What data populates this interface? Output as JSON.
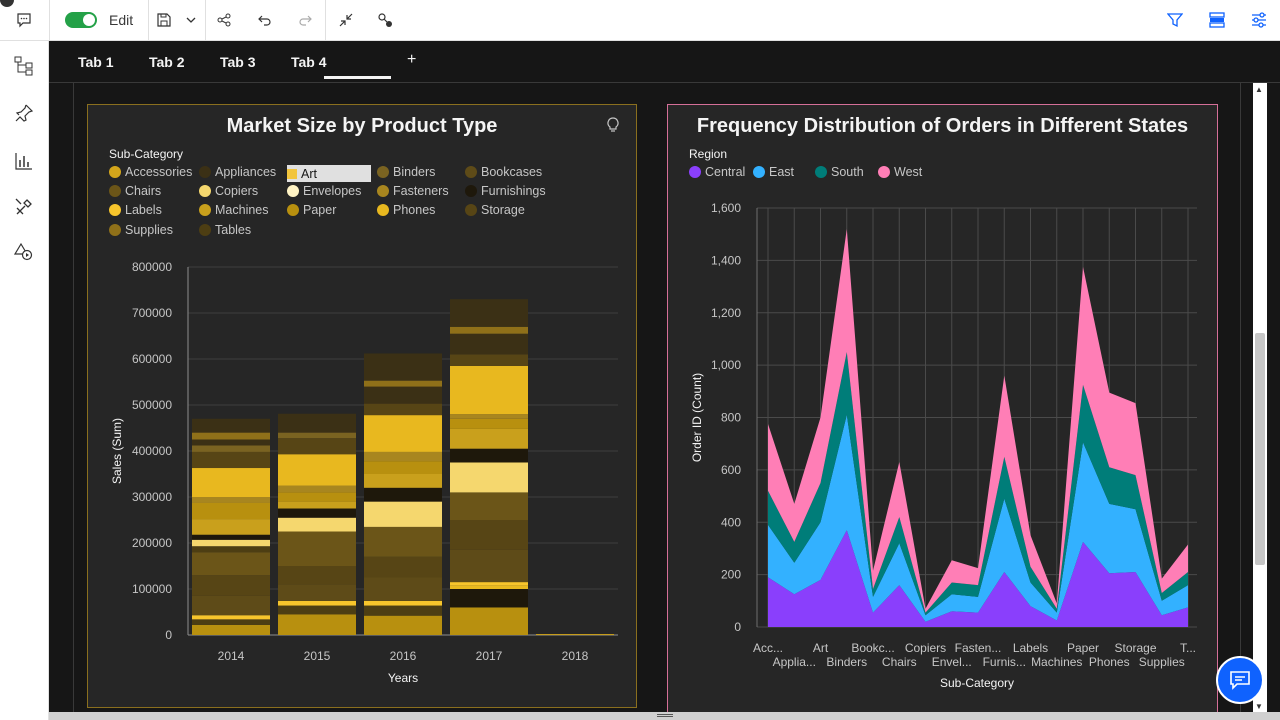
{
  "toolbar": {
    "edit_label": "Edit",
    "icons": [
      "comment-icon",
      "toggle-switch",
      "save-icon",
      "chevron-down-icon",
      "share-icon",
      "undo-icon",
      "redo-icon",
      "collapse-icon",
      "connect-icon",
      "filter-icon",
      "data-icon",
      "settings-icon"
    ]
  },
  "sidebar": {
    "icons": [
      "tree-icon",
      "pin-icon",
      "bar-chart-icon",
      "tools-icon",
      "shapes-icon"
    ]
  },
  "tabs": [
    {
      "label": "Tab 1"
    },
    {
      "label": "Tab 2"
    },
    {
      "label": "Tab 3"
    },
    {
      "label": "Tab 4"
    }
  ],
  "tab_add": "+",
  "active_tab": "Tab 4",
  "widget1": {
    "title": "Market Size by Product Type",
    "legend_title": "Sub-Category",
    "legend": [
      {
        "label": "Accessories",
        "color": "#d4a61b"
      },
      {
        "label": "Appliances",
        "color": "#3b3015"
      },
      {
        "label": "Art",
        "color": "#f2c53d"
      },
      {
        "label": "Binders",
        "color": "#7a6321"
      },
      {
        "label": "Bookcases",
        "color": "#5e4b18"
      },
      {
        "label": "Chairs",
        "color": "#6b5518"
      },
      {
        "label": "Copiers",
        "color": "#f5d76e"
      },
      {
        "label": "Envelopes",
        "color": "#fff3c4"
      },
      {
        "label": "Fasteners",
        "color": "#a8861f"
      },
      {
        "label": "Furnishings",
        "color": "#1e180b"
      },
      {
        "label": "Labels",
        "color": "#f7c52c"
      },
      {
        "label": "Machines",
        "color": "#c9a01c"
      },
      {
        "label": "Paper",
        "color": "#b8900f"
      },
      {
        "label": "Phones",
        "color": "#e8b81f"
      },
      {
        "label": "Storage",
        "color": "#574515"
      },
      {
        "label": "Supplies",
        "color": "#8f7019"
      },
      {
        "label": "Tables",
        "color": "#4d3e13"
      }
    ],
    "selected_legend": "Art"
  },
  "widget2": {
    "title": "Frequency Distribution of Orders in Different States",
    "legend_title": "Region",
    "legend": [
      {
        "label": "Central",
        "color": "#8a3ffc"
      },
      {
        "label": "East",
        "color": "#33b1ff"
      },
      {
        "label": "South",
        "color": "#007d79"
      },
      {
        "label": "West",
        "color": "#ff7eb6"
      }
    ]
  },
  "chart_data": [
    {
      "type": "bar",
      "title": "Market Size by Product Type",
      "xlabel": "Years",
      "ylabel": "Sales (Sum)",
      "categories": [
        "2014",
        "2015",
        "2016",
        "2017",
        "2018"
      ],
      "totals": [
        470000,
        480000,
        610000,
        730000,
        2000
      ],
      "ylim": [
        0,
        800000
      ],
      "yticks": [
        "0",
        "100000",
        "200000",
        "300000",
        "400000",
        "500000",
        "600000",
        "700000",
        "800000"
      ],
      "stacked": true,
      "segments": [
        [
          [
            0,
            22000,
            "#b8900f"
          ],
          [
            22000,
            34000,
            "#4d3e13"
          ],
          [
            34000,
            43000,
            "#f7c52c"
          ],
          [
            43000,
            85000,
            "#5e4b18"
          ],
          [
            85000,
            130000,
            "#574515"
          ],
          [
            130000,
            180000,
            "#6b5518"
          ],
          [
            180000,
            193000,
            "#4d3e13"
          ],
          [
            193000,
            207000,
            "#f5d76e"
          ],
          [
            207000,
            218000,
            "#1e180b"
          ],
          [
            218000,
            252000,
            "#c9a01c"
          ],
          [
            252000,
            287000,
            "#b8900f"
          ],
          [
            287000,
            300000,
            "#a8861f"
          ],
          [
            300000,
            363000,
            "#e8b81f"
          ],
          [
            363000,
            398000,
            "#574515"
          ],
          [
            398000,
            412000,
            "#7a6321"
          ],
          [
            412000,
            425000,
            "#3b3015"
          ],
          [
            425000,
            440000,
            "#8f7019"
          ],
          [
            440000,
            470000,
            "#3b3015"
          ]
        ],
        [
          [
            0,
            45000,
            "#b8900f"
          ],
          [
            45000,
            64000,
            "#4d3e13"
          ],
          [
            64000,
            74000,
            "#f7c52c"
          ],
          [
            74000,
            110000,
            "#5e4b18"
          ],
          [
            110000,
            150000,
            "#574515"
          ],
          [
            150000,
            225000,
            "#6b5518"
          ],
          [
            225000,
            255000,
            "#f5d76e"
          ],
          [
            255000,
            275000,
            "#1e180b"
          ],
          [
            275000,
            290000,
            "#c9a01c"
          ],
          [
            290000,
            310000,
            "#b8900f"
          ],
          [
            310000,
            325000,
            "#a8861f"
          ],
          [
            325000,
            393000,
            "#e8b81f"
          ],
          [
            393000,
            428000,
            "#574515"
          ],
          [
            428000,
            440000,
            "#7a6321"
          ],
          [
            440000,
            481000,
            "#3b3015"
          ]
        ],
        [
          [
            0,
            42000,
            "#b8900f"
          ],
          [
            42000,
            64000,
            "#4d3e13"
          ],
          [
            64000,
            74000,
            "#f7c52c"
          ],
          [
            74000,
            125000,
            "#5e4b18"
          ],
          [
            125000,
            170000,
            "#574515"
          ],
          [
            170000,
            235000,
            "#6b5518"
          ],
          [
            235000,
            290000,
            "#f5d76e"
          ],
          [
            290000,
            320000,
            "#1e180b"
          ],
          [
            320000,
            350000,
            "#c9a01c"
          ],
          [
            350000,
            378000,
            "#b8900f"
          ],
          [
            378000,
            398000,
            "#a8861f"
          ],
          [
            398000,
            478000,
            "#e8b81f"
          ],
          [
            478000,
            503000,
            "#574515"
          ],
          [
            503000,
            540000,
            "#3b3015"
          ],
          [
            540000,
            553000,
            "#8f7019"
          ],
          [
            553000,
            612000,
            "#3b3015"
          ]
        ],
        [
          [
            0,
            60000,
            "#b8900f"
          ],
          [
            60000,
            100000,
            "#1e180b"
          ],
          [
            100000,
            108000,
            "#e8b81f"
          ],
          [
            108000,
            115000,
            "#f7c52c"
          ],
          [
            115000,
            185000,
            "#5e4b18"
          ],
          [
            185000,
            250000,
            "#574515"
          ],
          [
            250000,
            310000,
            "#6b5518"
          ],
          [
            310000,
            375000,
            "#f5d76e"
          ],
          [
            375000,
            405000,
            "#1e180b"
          ],
          [
            405000,
            448000,
            "#c9a01c"
          ],
          [
            448000,
            470000,
            "#b8900f"
          ],
          [
            470000,
            480000,
            "#a8861f"
          ],
          [
            480000,
            585000,
            "#e8b81f"
          ],
          [
            585000,
            610000,
            "#574515"
          ],
          [
            610000,
            655000,
            "#3b3015"
          ],
          [
            655000,
            670000,
            "#8f7019"
          ],
          [
            670000,
            730000,
            "#3b3015"
          ]
        ],
        [
          [
            0,
            2000,
            "#d4a61b"
          ]
        ]
      ]
    },
    {
      "type": "area",
      "title": "Frequency Distribution of Orders in Different States",
      "xlabel": "Sub-Category",
      "ylabel": "Order ID (Count)",
      "ylim": [
        0,
        1600
      ],
      "yticks": [
        "0",
        "200",
        "400",
        "600",
        "800",
        "1,000",
        "1,200",
        "1,400",
        "1,600"
      ],
      "x_labels_top": [
        "Acc...",
        "Art",
        "Bookc...",
        "Copiers",
        "Fasten...",
        "Labels",
        "Paper",
        "Storage",
        "T..."
      ],
      "x_labels_bottom": [
        "Applia...",
        "Binders",
        "Chairs",
        "Envel...",
        "Furnis...",
        "Machines",
        "Phones",
        "Supplies"
      ],
      "categories": [
        "Accessories",
        "Appliances",
        "Art",
        "Binders",
        "Bookcases",
        "Chairs",
        "Copiers",
        "Envelopes",
        "Fasteners",
        "Furnishings",
        "Labels",
        "Machines",
        "Paper",
        "Phones",
        "Storage",
        "Supplies",
        "Tables"
      ],
      "stacked": true,
      "series": [
        {
          "name": "Central",
          "color": "#8a3ffc",
          "values": [
            190,
            125,
            180,
            370,
            55,
            160,
            20,
            60,
            55,
            210,
            80,
            25,
            325,
            205,
            210,
            45,
            75
          ]
        },
        {
          "name": "East",
          "color": "#33b1ff",
          "values": [
            200,
            120,
            220,
            440,
            60,
            160,
            25,
            65,
            60,
            280,
            90,
            30,
            380,
            265,
            240,
            55,
            85
          ]
        },
        {
          "name": "South",
          "color": "#007d79",
          "values": [
            130,
            80,
            150,
            240,
            30,
            100,
            10,
            45,
            45,
            160,
            60,
            15,
            220,
            140,
            130,
            30,
            50
          ]
        },
        {
          "name": "West",
          "color": "#ff7eb6",
          "values": [
            255,
            145,
            250,
            470,
            70,
            210,
            15,
            85,
            65,
            310,
            120,
            20,
            450,
            285,
            275,
            55,
            105
          ]
        }
      ]
    }
  ]
}
